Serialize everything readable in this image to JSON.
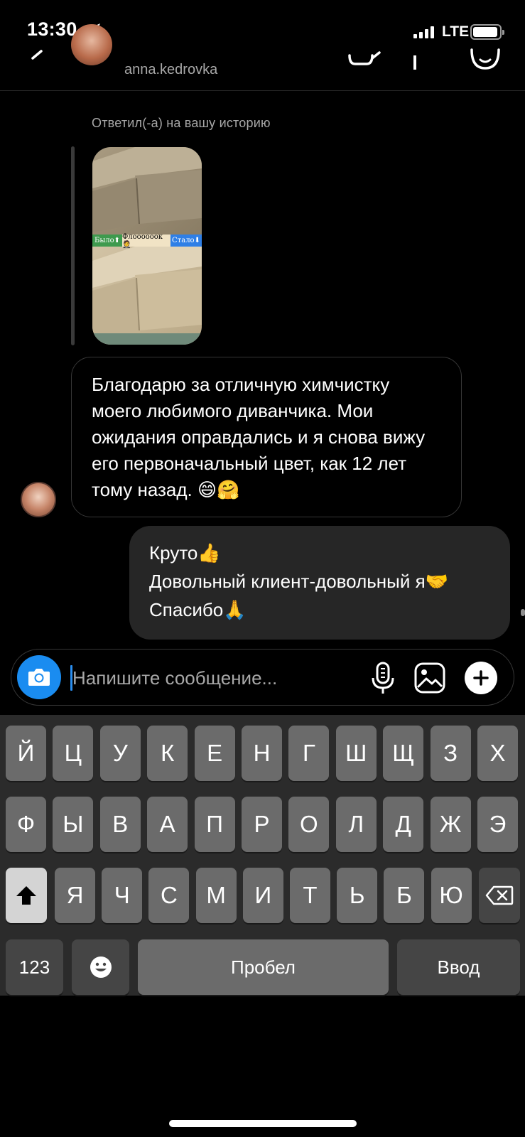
{
  "status_bar": {
    "time": "13:30",
    "network": "LTE",
    "signal_bars": 4,
    "battery_level": 0.85
  },
  "header": {
    "username": "anna.kedrovka"
  },
  "story_reply": {
    "label": "Ответил(-а) на вашу историю",
    "strip_before": "Было⬆",
    "strip_middle": "Флоооооок🤵",
    "strip_after": "Стало⬇"
  },
  "messages": {
    "incoming": {
      "text": "Благодарю за отличную химчистку моего любимого диванчика. Мои ожидания оправдались и я снова вижу его первоначальный цвет, как 12 лет тому назад. 😄🤗"
    },
    "outgoing": {
      "line1": "Круто👍",
      "line2": "Довольный клиент-довольный я🤝",
      "line3": "Спасибо🙏"
    }
  },
  "composer": {
    "placeholder": "Напишите сообщение..."
  },
  "keyboard": {
    "row1": [
      "Й",
      "Ц",
      "У",
      "К",
      "Е",
      "Н",
      "Г",
      "Ш",
      "Щ",
      "З",
      "Х"
    ],
    "row2": [
      "Ф",
      "Ы",
      "В",
      "А",
      "П",
      "Р",
      "О",
      "Л",
      "Д",
      "Ж",
      "Э"
    ],
    "row3": [
      "Я",
      "Ч",
      "С",
      "М",
      "И",
      "Т",
      "Ь",
      "Б",
      "Ю"
    ],
    "numbers_label": "123",
    "space_label": "Пробел",
    "return_label": "Ввод"
  }
}
